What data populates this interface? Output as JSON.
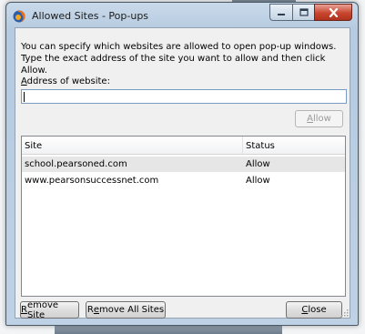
{
  "window": {
    "title": "Allowed Sites - Pop-ups",
    "close_color": "#c9462f"
  },
  "intro_text": "You can specify which websites are allowed to open pop-up windows. Type the exact address of the site you want to allow and then click Allow.",
  "address": {
    "label_accel": "A",
    "label_rest": "ddress of website:",
    "value": "",
    "placeholder": ""
  },
  "buttons": {
    "allow_accel": "A",
    "allow_rest": "llow",
    "remove_site_accel": "R",
    "remove_site_rest": "emove Site",
    "remove_all_pre": "R",
    "remove_all_accel": "e",
    "remove_all_rest": "move All Sites",
    "close_accel": "C",
    "close_rest": "lose"
  },
  "list": {
    "columns": {
      "site": "Site",
      "status": "Status"
    },
    "rows": [
      {
        "site": "school.pearsoned.com",
        "status": "Allow"
      },
      {
        "site": "www.pearsonsuccessnet.com",
        "status": "Allow"
      }
    ]
  }
}
